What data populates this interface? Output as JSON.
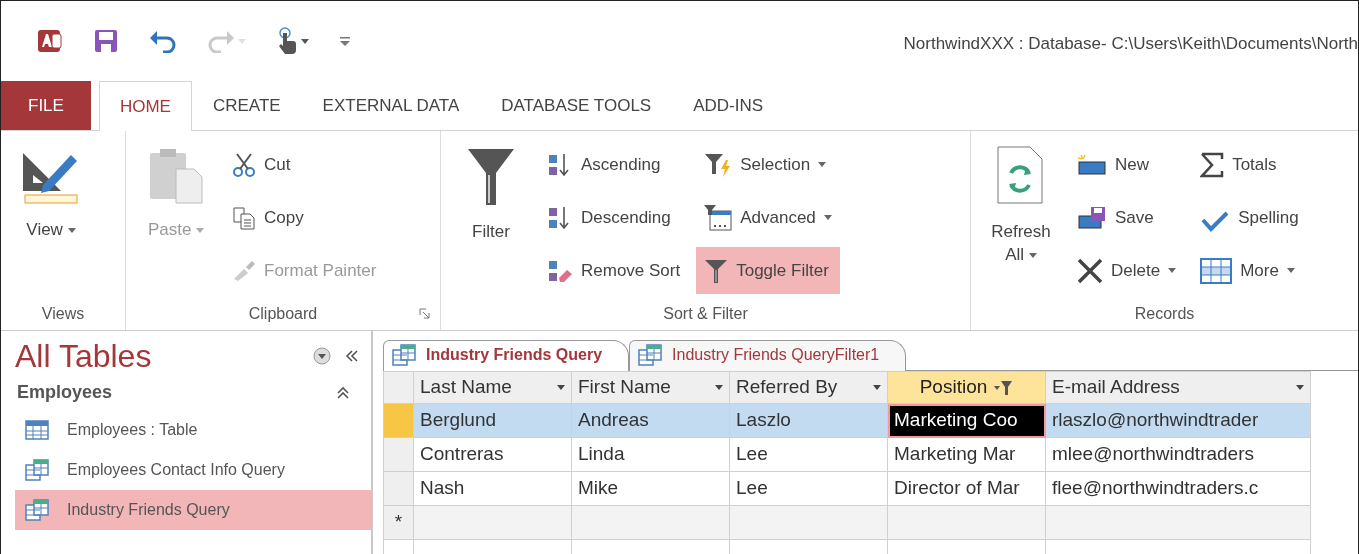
{
  "window": {
    "title": "NorthwindXXX : Database- C:\\Users\\Keith\\Documents\\North"
  },
  "quick_access": [
    {
      "kind": "app"
    },
    {
      "kind": "save"
    },
    {
      "kind": "undo"
    },
    {
      "kind": "redo",
      "dropdown": true,
      "disabled": true
    },
    {
      "kind": "touch",
      "dropdown": true
    },
    {
      "kind": "customize"
    }
  ],
  "tabs": [
    {
      "label": "FILE",
      "kind": "file",
      "selected": false
    },
    {
      "label": "HOME",
      "kind": "tab",
      "selected": true
    },
    {
      "label": "CREATE",
      "kind": "tab",
      "selected": false
    },
    {
      "label": "EXTERNAL DATA",
      "kind": "tab",
      "selected": false
    },
    {
      "label": "DATABASE TOOLS",
      "kind": "tab",
      "selected": false
    },
    {
      "label": "ADD-INS",
      "kind": "tab",
      "selected": false
    }
  ],
  "ribbon": [
    {
      "label": "Views",
      "launcher": false,
      "columns": [
        [
          {
            "kind": "large",
            "label": "View",
            "dropdown": true,
            "disabled": false,
            "selected": false
          }
        ]
      ]
    },
    {
      "label": "Clipboard",
      "launcher": true,
      "columns": [
        [
          {
            "kind": "large",
            "label": "Paste",
            "dropdown": true,
            "disabled": true,
            "selected": false
          }
        ],
        [
          {
            "kind": "small",
            "label": "Cut",
            "dropdown": false,
            "disabled": false,
            "selected": false
          },
          {
            "kind": "small",
            "label": "Copy",
            "dropdown": false,
            "disabled": false,
            "selected": false
          },
          {
            "kind": "small",
            "label": "Format Painter",
            "dropdown": false,
            "disabled": true,
            "selected": false
          }
        ]
      ]
    },
    {
      "label": "Sort & Filter",
      "launcher": false,
      "columns": [
        [
          {
            "kind": "large",
            "label": "Filter",
            "dropdown": false,
            "disabled": false,
            "selected": false
          }
        ],
        [
          {
            "kind": "small",
            "label": "Ascending",
            "dropdown": false,
            "disabled": false,
            "selected": false
          },
          {
            "kind": "small",
            "label": "Descending",
            "dropdown": false,
            "disabled": false,
            "selected": false
          },
          {
            "kind": "small",
            "label": "Remove Sort",
            "dropdown": false,
            "disabled": false,
            "selected": false
          }
        ],
        [
          {
            "kind": "small",
            "label": "Selection",
            "dropdown": true,
            "disabled": false,
            "selected": false
          },
          {
            "kind": "small",
            "label": "Advanced",
            "dropdown": true,
            "disabled": false,
            "selected": false
          },
          {
            "kind": "small",
            "label": "Toggle Filter",
            "dropdown": false,
            "disabled": false,
            "selected": true
          }
        ]
      ]
    },
    {
      "label": "Records",
      "launcher": false,
      "columns": [
        [
          {
            "kind": "large",
            "label": "Refresh All",
            "dropdown": true,
            "disabled": false,
            "selected": false
          }
        ],
        [
          {
            "kind": "small",
            "label": "New",
            "dropdown": false,
            "disabled": false,
            "selected": false
          },
          {
            "kind": "small",
            "label": "Save",
            "dropdown": false,
            "disabled": false,
            "selected": false
          },
          {
            "kind": "small",
            "label": "Delete",
            "dropdown": true,
            "disabled": false,
            "selected": false
          }
        ],
        [
          {
            "kind": "small",
            "label": "Totals",
            "dropdown": false,
            "disabled": false,
            "selected": false
          },
          {
            "kind": "small",
            "label": "Spelling",
            "dropdown": false,
            "disabled": false,
            "selected": false
          },
          {
            "kind": "small",
            "label": "More",
            "dropdown": true,
            "disabled": false,
            "selected": false
          }
        ]
      ]
    }
  ],
  "navigation": {
    "title": "All Tables",
    "group": {
      "label": "Employees",
      "expanded": true
    },
    "items": [
      {
        "label": "Employees : Table",
        "kind": "table",
        "selected": false
      },
      {
        "label": "Employees Contact Info Query",
        "kind": "query",
        "selected": false
      },
      {
        "label": "Industry Friends Query",
        "kind": "query",
        "selected": true
      }
    ]
  },
  "document_tabs": [
    {
      "label": "Industry Friends Query",
      "selected": true
    },
    {
      "label": "Industry Friends QueryFilter1",
      "selected": false
    }
  ],
  "datasheet": {
    "columns": [
      {
        "label": "Last Name",
        "filtered": false
      },
      {
        "label": "First Name",
        "filtered": false
      },
      {
        "label": "Referred By",
        "filtered": false
      },
      {
        "label": "Position",
        "filtered": true
      },
      {
        "label": "E-mail Address",
        "filtered": false
      }
    ],
    "rows": [
      {
        "kind": "record",
        "current": true,
        "selected": true,
        "cells": [
          {
            "text": "Berglund",
            "selected": false
          },
          {
            "text": "Andreas",
            "selected": false
          },
          {
            "text": "Laszlo",
            "selected": false
          },
          {
            "text": "Marketing Coo",
            "selected": true
          },
          {
            "text": "rlaszlo@northwindtrader",
            "selected": false
          }
        ]
      },
      {
        "kind": "record",
        "current": false,
        "selected": false,
        "cells": [
          {
            "text": "Contreras",
            "selected": false
          },
          {
            "text": "Linda",
            "selected": false
          },
          {
            "text": "Lee",
            "selected": false
          },
          {
            "text": "Marketing Mar",
            "selected": false
          },
          {
            "text": "mlee@northwindtraders",
            "selected": false
          }
        ]
      },
      {
        "kind": "record",
        "current": false,
        "selected": false,
        "cells": [
          {
            "text": "Nash",
            "selected": false
          },
          {
            "text": "Mike",
            "selected": false
          },
          {
            "text": "Lee",
            "selected": false
          },
          {
            "text": "Director of Mar",
            "selected": false
          },
          {
            "text": "flee@northwindtraders.c",
            "selected": false
          }
        ]
      },
      {
        "kind": "new",
        "marker": "*"
      }
    ]
  }
}
